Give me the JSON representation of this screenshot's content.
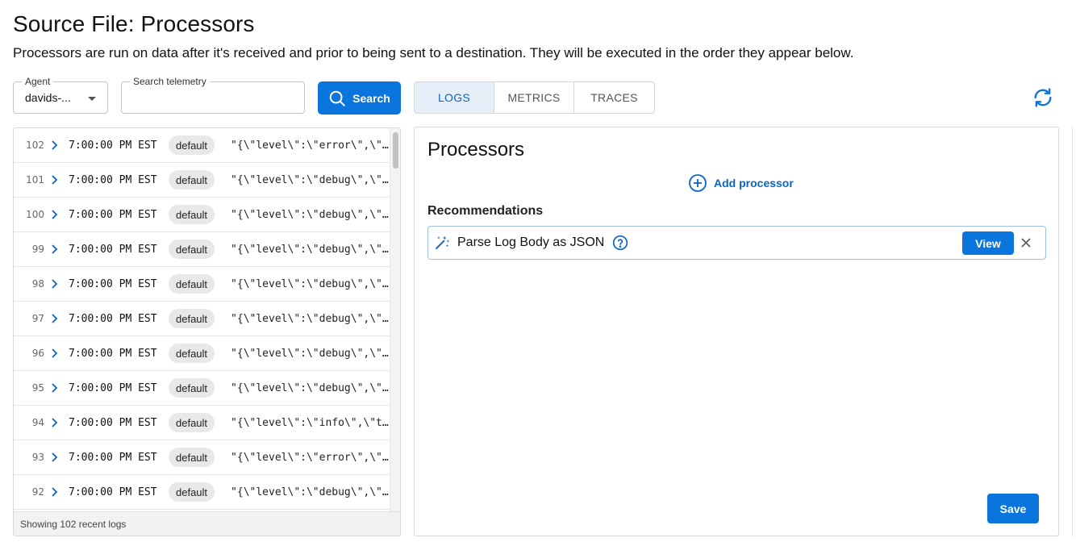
{
  "header": {
    "title": "Source File: Processors",
    "subtitle": "Processors are run on data after it's received and prior to being sent to a destination. They will be executed in the order they appear below."
  },
  "filters": {
    "agent_label": "Agent",
    "agent_value": "davids-...",
    "search_label": "Search telemetry",
    "search_value": "",
    "search_button": "Search"
  },
  "tabs": [
    {
      "label": "LOGS",
      "active": true
    },
    {
      "label": "METRICS",
      "active": false
    },
    {
      "label": "TRACES",
      "active": false
    }
  ],
  "logs": {
    "rows": [
      {
        "num": "102",
        "time": "7:00:00 PM EST",
        "badge": "default",
        "body": "\"{\\\"level\\\":\\\"error\\\",\\\"timestamp"
      },
      {
        "num": "101",
        "time": "7:00:00 PM EST",
        "badge": "default",
        "body": "\"{\\\"level\\\":\\\"debug\\\",\\\"timestamp"
      },
      {
        "num": "100",
        "time": "7:00:00 PM EST",
        "badge": "default",
        "body": "\"{\\\"level\\\":\\\"debug\\\",\\\"timestamp"
      },
      {
        "num": "99",
        "time": "7:00:00 PM EST",
        "badge": "default",
        "body": "\"{\\\"level\\\":\\\"debug\\\",\\\"timestamp"
      },
      {
        "num": "98",
        "time": "7:00:00 PM EST",
        "badge": "default",
        "body": "\"{\\\"level\\\":\\\"debug\\\",\\\"timestamp"
      },
      {
        "num": "97",
        "time": "7:00:00 PM EST",
        "badge": "default",
        "body": "\"{\\\"level\\\":\\\"debug\\\",\\\"timestamp"
      },
      {
        "num": "96",
        "time": "7:00:00 PM EST",
        "badge": "default",
        "body": "\"{\\\"level\\\":\\\"debug\\\",\\\"timestamp"
      },
      {
        "num": "95",
        "time": "7:00:00 PM EST",
        "badge": "default",
        "body": "\"{\\\"level\\\":\\\"debug\\\",\\\"timestamp"
      },
      {
        "num": "94",
        "time": "7:00:00 PM EST",
        "badge": "default",
        "body": "\"{\\\"level\\\":\\\"info\\\",\\\"timestamp"
      },
      {
        "num": "93",
        "time": "7:00:00 PM EST",
        "badge": "default",
        "body": "\"{\\\"level\\\":\\\"error\\\",\\\"timestamp"
      },
      {
        "num": "92",
        "time": "7:00:00 PM EST",
        "badge": "default",
        "body": "\"{\\\"level\\\":\\\"debug\\\",\\\"timestamp"
      }
    ],
    "footer": "Showing 102 recent logs"
  },
  "processors": {
    "title": "Processors",
    "add_label": "Add processor",
    "recommendations_title": "Recommendations",
    "recommendation": {
      "label": "Parse Log Body as JSON",
      "view_label": "View"
    },
    "save_label": "Save"
  },
  "icons": {
    "search": "search-icon",
    "refresh": "refresh-icon",
    "add": "add-circle-icon",
    "wand": "magic-wand-icon",
    "help": "help-circle-icon",
    "close": "close-icon",
    "chevron": "chevron-right-icon"
  },
  "colors": {
    "primary": "#0a75dc",
    "tab_active_bg": "#e6eef8",
    "badge_bg": "#e8e8e8"
  }
}
